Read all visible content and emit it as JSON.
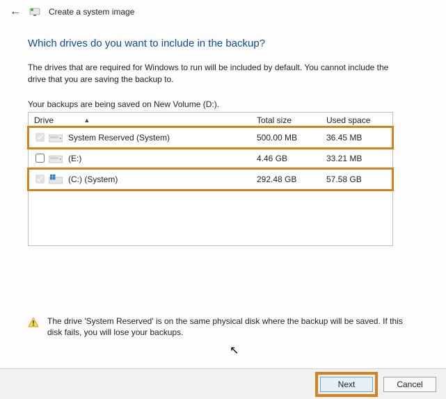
{
  "titlebar": {
    "title": "Create a system image"
  },
  "heading": "Which drives do you want to include in the backup?",
  "description": "The drives that are required for Windows to run will be included by default. You cannot include the drive that you are saving the backup to.",
  "saved_to": "Your backups are being saved on New Volume (D:).",
  "table": {
    "col_drive": "Drive",
    "col_total": "Total size",
    "col_used": "Used space",
    "rows": [
      {
        "label": "System Reserved (System)",
        "total": "500.00 MB",
        "used": "36.45 MB",
        "checked": true,
        "disabled": true,
        "highlight": true,
        "win": false
      },
      {
        "label": "(E:)",
        "total": "4.46 GB",
        "used": "33.21 MB",
        "checked": false,
        "disabled": false,
        "highlight": false,
        "win": false
      },
      {
        "label": "(C:) (System)",
        "total": "292.48 GB",
        "used": "57.58 GB",
        "checked": true,
        "disabled": true,
        "highlight": true,
        "win": true
      }
    ]
  },
  "warning": "The drive 'System Reserved' is on the same physical disk where the backup will be saved. If this disk fails, you will lose your backups.",
  "buttons": {
    "next": "Next",
    "cancel": "Cancel"
  }
}
